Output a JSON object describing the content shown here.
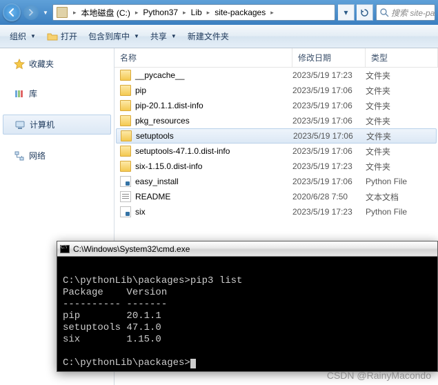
{
  "address": {
    "breadcrumbs": [
      "本地磁盘 (C:)",
      "Python37",
      "Lib",
      "site-packages"
    ]
  },
  "search": {
    "placeholder": "搜索 site-pack"
  },
  "toolbar": {
    "organize": "组织",
    "open": "打开",
    "include": "包含到库中",
    "share": "共享",
    "newfolder": "新建文件夹"
  },
  "sidebar": {
    "favorites": "收藏夹",
    "library": "库",
    "computer": "计算机",
    "network": "网络"
  },
  "columns": {
    "name": "名称",
    "date": "修改日期",
    "type": "类型"
  },
  "files": [
    {
      "icon": "folder",
      "name": "__pycache__",
      "date": "2023/5/19 17:23",
      "type": "文件夹",
      "sel": false
    },
    {
      "icon": "folder",
      "name": "pip",
      "date": "2023/5/19 17:06",
      "type": "文件夹",
      "sel": false
    },
    {
      "icon": "folder",
      "name": "pip-20.1.1.dist-info",
      "date": "2023/5/19 17:06",
      "type": "文件夹",
      "sel": false
    },
    {
      "icon": "folder",
      "name": "pkg_resources",
      "date": "2023/5/19 17:06",
      "type": "文件夹",
      "sel": false
    },
    {
      "icon": "folder",
      "name": "setuptools",
      "date": "2023/5/19 17:06",
      "type": "文件夹",
      "sel": true
    },
    {
      "icon": "folder",
      "name": "setuptools-47.1.0.dist-info",
      "date": "2023/5/19 17:06",
      "type": "文件夹",
      "sel": false
    },
    {
      "icon": "folder",
      "name": "six-1.15.0.dist-info",
      "date": "2023/5/19 17:23",
      "type": "文件夹",
      "sel": false
    },
    {
      "icon": "py",
      "name": "easy_install",
      "date": "2023/5/19 17:06",
      "type": "Python File",
      "sel": false
    },
    {
      "icon": "txt",
      "name": "README",
      "date": "2020/6/28 7:50",
      "type": "文本文档",
      "sel": false
    },
    {
      "icon": "py",
      "name": "six",
      "date": "2023/5/19 17:23",
      "type": "Python File",
      "sel": false
    }
  ],
  "cmd": {
    "title": "C:\\Windows\\System32\\cmd.exe",
    "lines": [
      "",
      "C:\\pythonLib\\packages>pip3 list",
      "Package    Version",
      "---------- -------",
      "pip        20.1.1",
      "setuptools 47.1.0",
      "six        1.15.0",
      "",
      "C:\\pythonLib\\packages>"
    ]
  },
  "watermark": "CSDN @RainyMacondo"
}
